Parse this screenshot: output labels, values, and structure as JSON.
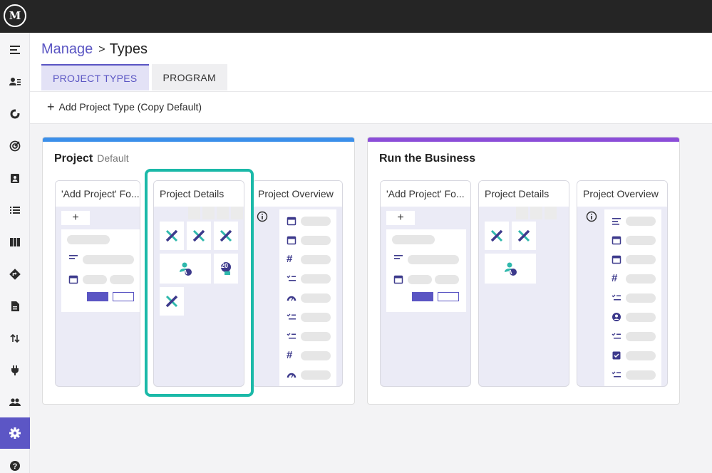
{
  "app": {
    "logo_text": "M"
  },
  "breadcrumb": {
    "parent": "Manage",
    "separator": ">",
    "current": "Types"
  },
  "tabs": [
    {
      "label": "PROJECT TYPES",
      "active": true
    },
    {
      "label": "PROGRAM",
      "active": false
    }
  ],
  "toolbar": {
    "add_label": "Add Project Type (Copy Default)",
    "add_icon": "plus-icon"
  },
  "sidebar": {
    "items": [
      {
        "icon": "menu-icon"
      },
      {
        "icon": "people-list-icon"
      },
      {
        "icon": "refresh-circle-icon"
      },
      {
        "icon": "target-icon"
      },
      {
        "icon": "clipboard-person-icon"
      },
      {
        "icon": "list-icon"
      },
      {
        "icon": "columns-icon"
      },
      {
        "icon": "directions-icon"
      },
      {
        "icon": "document-icon"
      },
      {
        "icon": "swap-vertical-icon"
      },
      {
        "icon": "plug-icon"
      },
      {
        "icon": "group-icon"
      },
      {
        "icon": "settings-icon",
        "active": true
      },
      {
        "icon": "help-icon"
      }
    ]
  },
  "colors": {
    "accent": "#5a55c3",
    "highlight": "#1bb9a8",
    "project_stripe": "#3b8fea",
    "business_stripe": "#8b4dd8"
  },
  "cards": [
    {
      "title": "Project",
      "subtitle": "Default",
      "panels": [
        {
          "title": "'Add Project' Fo..."
        },
        {
          "title": "Project Details"
        },
        {
          "title": "Project Overview"
        }
      ]
    },
    {
      "title": "Run the Business",
      "subtitle": "",
      "panels": [
        {
          "title": "'Add Project' Fo..."
        },
        {
          "title": "Project Details"
        },
        {
          "title": "Project Overview"
        }
      ]
    }
  ],
  "badges": {
    "number_badge": "20",
    "avatar_badge": "A"
  },
  "form_icons": {
    "add_button": "+",
    "detail_tiles": [
      "tools-icon",
      "tools-icon",
      "tools-icon",
      "person-icon",
      "counter-icon",
      "tools-icon"
    ],
    "overview_rows_project": [
      "calendar-icon",
      "calendar-icon",
      "hash-icon",
      "checklist-icon",
      "gauge-icon",
      "checklist-icon",
      "checklist-icon",
      "hash-icon",
      "gauge-icon"
    ],
    "overview_rows_business": [
      "text-lines-icon",
      "calendar-icon",
      "calendar-icon",
      "hash-icon",
      "checklist-icon",
      "person-circle-icon",
      "checklist-icon",
      "checkbox-icon",
      "checklist-icon"
    ],
    "overview_symbols": {
      "hash": "#"
    }
  }
}
